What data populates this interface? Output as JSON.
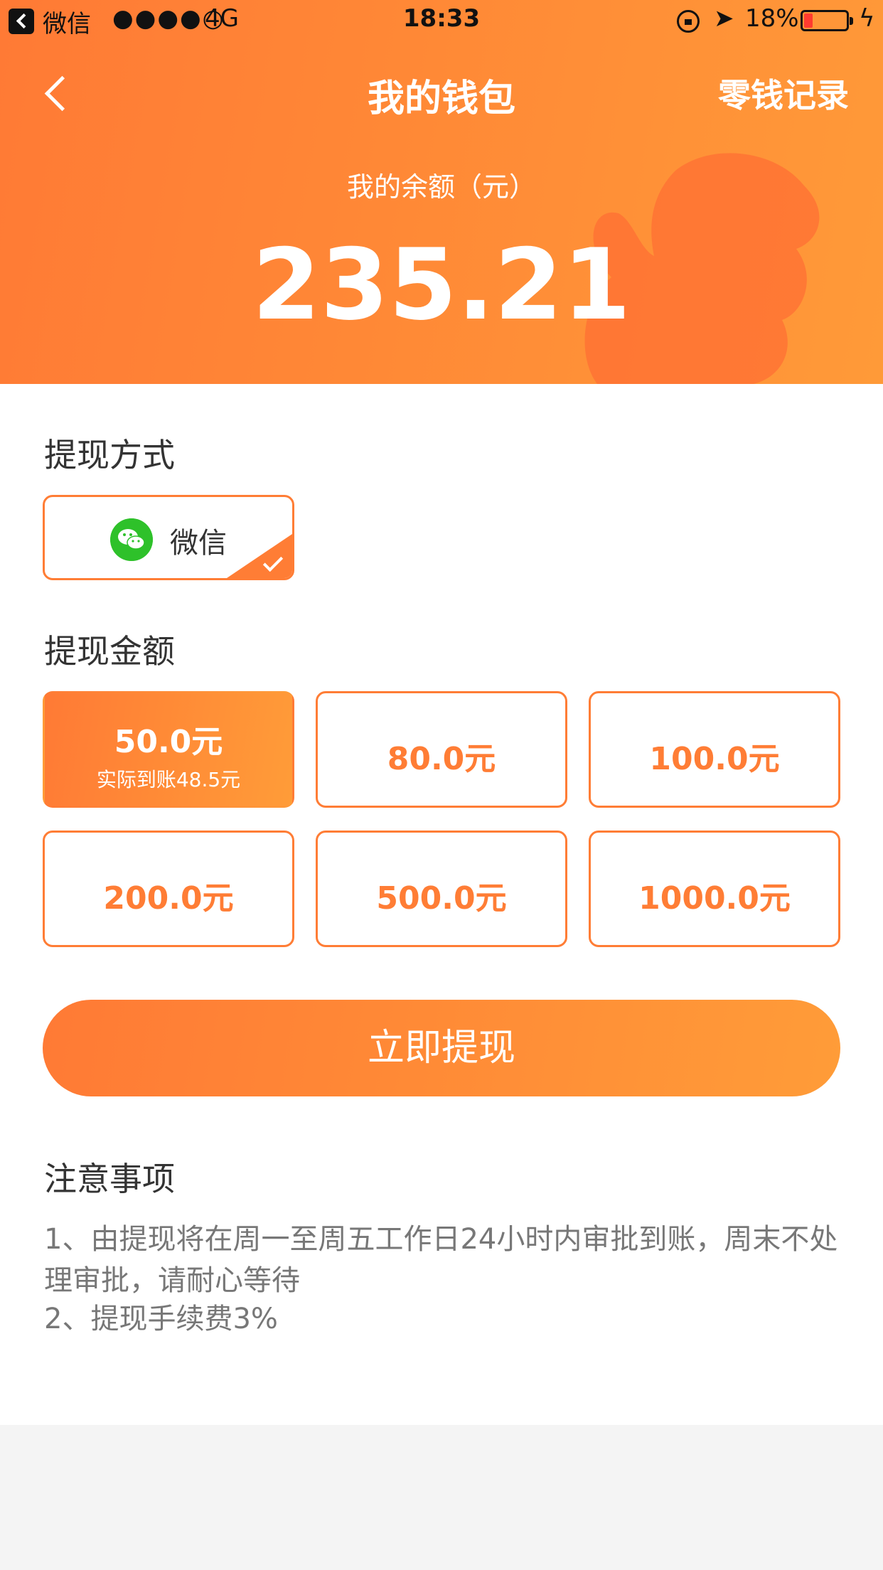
{
  "status_bar": {
    "back_app": "微信",
    "signal": "●●●●○",
    "network": "4G",
    "time": "18:33",
    "battery": "18%"
  },
  "nav": {
    "title": "我的钱包",
    "right_link": "零钱记录"
  },
  "balance": {
    "label": "我的余额（元）",
    "amount": "235.21"
  },
  "withdraw_method": {
    "title": "提现方式",
    "option": "微信"
  },
  "withdraw_amount": {
    "title": "提现金额",
    "options": [
      {
        "label": "50.0元",
        "sub": "实际到账48.5元",
        "selected": true
      },
      {
        "label": "80.0元"
      },
      {
        "label": "100.0元"
      },
      {
        "label": "200.0元"
      },
      {
        "label": "500.0元"
      },
      {
        "label": "1000.0元"
      }
    ]
  },
  "submit_label": "立即提现",
  "notes": {
    "title": "注意事项",
    "items": [
      "1、由提现将在周一至周五工作日24小时内审批到账，周末不处理审批，请耐心等待",
      "2、提现手续费3%"
    ]
  },
  "colors": {
    "accent": "#ff7d35",
    "accent_light": "#ff9c38",
    "wechat_green": "#2ec12a"
  }
}
